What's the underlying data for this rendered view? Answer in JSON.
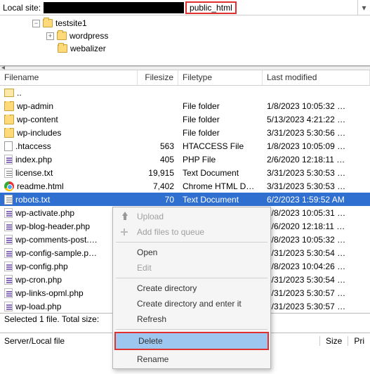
{
  "top": {
    "label": "Local site:",
    "path_highlight": "public_html"
  },
  "tree": {
    "items": [
      {
        "label": "testsite1",
        "expander": "−"
      },
      {
        "label": "wordpress",
        "expander": "+"
      },
      {
        "label": "webalizer"
      }
    ]
  },
  "columns": {
    "name": "Filename",
    "size": "Filesize",
    "type": "Filetype",
    "mod": "Last modified"
  },
  "rows": [
    {
      "icon": "up",
      "name": "..",
      "size": "",
      "type": "",
      "mod": ""
    },
    {
      "icon": "folder",
      "name": "wp-admin",
      "size": "",
      "type": "File folder",
      "mod": "1/8/2023 10:05:32 …"
    },
    {
      "icon": "folder",
      "name": "wp-content",
      "size": "",
      "type": "File folder",
      "mod": "5/13/2023 4:21:22 …"
    },
    {
      "icon": "folder",
      "name": "wp-includes",
      "size": "",
      "type": "File folder",
      "mod": "3/31/2023 5:30:56 …"
    },
    {
      "icon": "dot",
      "name": ".htaccess",
      "size": "563",
      "type": "HTACCESS File",
      "mod": "1/8/2023 10:05:09 …"
    },
    {
      "icon": "php",
      "name": "index.php",
      "size": "405",
      "type": "PHP File",
      "mod": "2/6/2020 12:18:11 …"
    },
    {
      "icon": "txt",
      "name": "license.txt",
      "size": "19,915",
      "type": "Text Document",
      "mod": "3/31/2023 5:30:53 …"
    },
    {
      "icon": "chrome",
      "name": "readme.html",
      "size": "7,402",
      "type": "Chrome HTML Do…",
      "mod": "3/31/2023 5:30:53 …"
    },
    {
      "icon": "txt",
      "name": "robots.txt",
      "size": "70",
      "type": "Text Document",
      "mod": "6/2/2023 1:59:52 AM",
      "selected": true
    },
    {
      "icon": "php",
      "name": "wp-activate.php",
      "size": "",
      "type": "",
      "mod": "1/8/2023 10:05:31 …"
    },
    {
      "icon": "php",
      "name": "wp-blog-header.php",
      "size": "",
      "type": "",
      "mod": "2/6/2020 12:18:11 …"
    },
    {
      "icon": "php",
      "name": "wp-comments-post.…",
      "size": "",
      "type": "",
      "mod": "1/8/2023 10:05:32 …"
    },
    {
      "icon": "php",
      "name": "wp-config-sample.p…",
      "size": "",
      "type": "",
      "mod": "3/31/2023 5:30:54 …"
    },
    {
      "icon": "php",
      "name": "wp-config.php",
      "size": "",
      "type": "",
      "mod": "1/8/2023 10:04:26 …"
    },
    {
      "icon": "php",
      "name": "wp-cron.php",
      "size": "",
      "type": "",
      "mod": "3/31/2023 5:30:54 …"
    },
    {
      "icon": "php",
      "name": "wp-links-opml.php",
      "size": "",
      "type": "",
      "mod": "3/31/2023 5:30:57 …"
    },
    {
      "icon": "php",
      "name": "wp-load.php",
      "size": "",
      "type": "",
      "mod": "3/31/2023 5:30:57 …"
    }
  ],
  "context": {
    "upload": "Upload",
    "add_queue": "Add files to queue",
    "open": "Open",
    "edit": "Edit",
    "create_dir": "Create directory",
    "create_dir_enter": "Create directory and enter it",
    "refresh": "Refresh",
    "delete": "Delete",
    "rename": "Rename"
  },
  "status_bar": "Selected 1 file. Total size:",
  "server_row": {
    "label": "Server/Local file",
    "size": "Size",
    "prio": "Pri"
  }
}
